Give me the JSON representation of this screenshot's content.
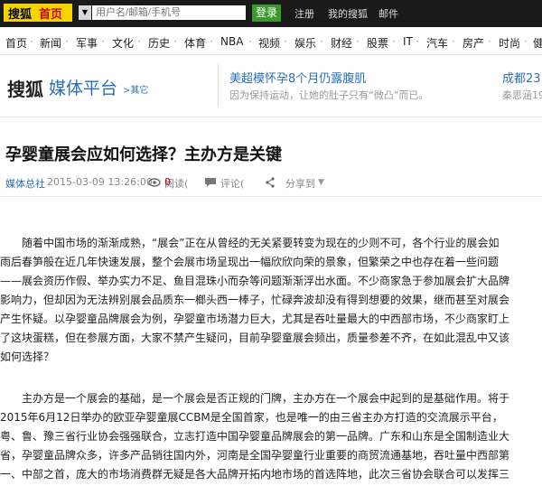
{
  "topbar": {
    "brand": "搜狐",
    "home": "首页",
    "search_placeholder": "用户名/邮箱/手机号",
    "login": "登录",
    "register": "注册",
    "my_sohu": "我的搜狐",
    "mail": "邮件"
  },
  "nav": {
    "items": [
      "首页",
      "新闻",
      "军事",
      "文化",
      "历史",
      "体育",
      "NBA",
      "视频",
      "娱乐",
      "财经",
      "股票",
      "IT",
      "汽车",
      "房产",
      "时尚",
      "健"
    ]
  },
  "header": {
    "sohu": "搜狐",
    "platform": "媒体平台",
    "more": ">其它",
    "headline1_title": "美超模怀孕8个月仍露腹肌",
    "headline1_sub": "因为保持运动，让她的肚子只有“微凸”而已。",
    "headline2_title": "成都23",
    "headline2_sub": "秦思涵19"
  },
  "article": {
    "title": "孕婴童展会应如何选择？主办方是关键",
    "source": "媒体总社",
    "date": "2015-03-09 13:26:00",
    "read_label": "阅读(",
    "read_count": "0",
    "close_paren": ")",
    "comment_label": "评论(",
    "share": "分享到",
    "lines": [
      "　　随着中国市场的渐渐成熟，“展会”正在从曾经的无关紧要转变为现在的少则不可，各个行业的展会如",
      "雨后春笋般在近几年快速发展，整个会展市场呈现出一幅欣欣向荣的景象，但繁荣之中也存在着一些问题",
      "——展会资历作假、举办实力不足、鱼目混珠小而杂等问题渐渐浮出水面。不少商家急于参加展会扩大品牌",
      "影响力，但却因为无法辨别展会品质东一榔头西一棒子，忙碌奔波却没有得到想要的效果，继而甚至对展会",
      "产生怀疑。以孕婴童品牌展会为例，孕婴童市场潜力巨大，尤其是吞吐量最大的中西部市场，不少商家盯上",
      "了这块蛋糕，但在参展方面，大家不禁产生疑问，目前孕婴童展会频出，质量参差不齐，在如此混乱中又该",
      "如何选择？",
      "",
      "　　主办方是一个展会的基础，是一个展会是否正规的门牌，主办方在一个展会中起到的是基础作用。将于",
      "2015年6月12日举办的欧亚孕婴童展CCBM是全国首家，也是唯一的由三省主办方打造的交流展示平台，",
      "粤、鲁、豫三省行业协会强强联合，立志打造中国孕婴童品牌展会的第一品牌。广东和山东是全国制造业大",
      "省，孕婴童品牌众多，许多产品销往国内外，河南是全国孕婴童行业重要的商贸流通基地，吞吐量中西部第",
      "一、中部之首，庞大的市场消费群无疑是各大品牌开拓内地市场的首选阵地，此次三省协会联合可以发挥三"
    ]
  },
  "colors": {
    "topbar_bg": "#1a1a1a",
    "logo_bg": "#f5d400",
    "login_bg": "#3c9a2c",
    "link_blue": "#2a6ebb",
    "count_red": "#c00"
  }
}
